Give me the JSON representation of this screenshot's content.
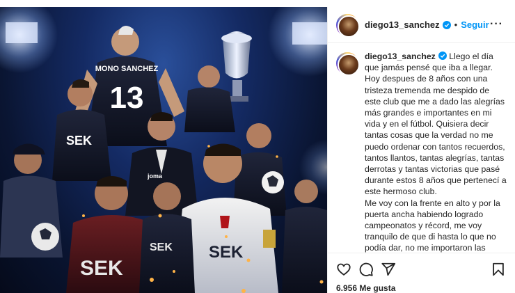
{
  "header": {
    "username": "diego13_sanchez",
    "separator": "•",
    "follow_label": "Seguir",
    "more_label": "···"
  },
  "caption": {
    "username": "diego13_sanchez",
    "paragraph1": "Llego el día que jamás pensé que iba a llegar. Hoy despues de 8 años con una tristeza tremenda me despido de este club que me a dado las alegrías más grandes e importantes en mi vida y en el fútbol. Quisiera decir tantas cosas que la verdad no me puedo ordenar con tantos recuerdos, tantos llantos, tantas alegrías, tantas derrotas y tantas victorias que pasé durante estos 8 años que pertenecí a este hermoso club.",
    "paragraph2": "Me voy con la frente en alto y por la puerta ancha habiendo logrado campeonatos y récord, me voy tranquilo de que di hasta lo que no podía dar, no me importaron las recomendaciones médicas siempre tuve en mente jugar todos los partidos sea como sea, talvez"
  },
  "image": {
    "jersey_name": "MONO SANCHEZ",
    "jersey_number": "13",
    "sponsor": "SEK",
    "brand": "joma"
  },
  "actions": {
    "likes_count": "6.956",
    "likes_label": "Me gusta"
  },
  "icons": [
    "verified-icon",
    "more-options-icon",
    "heart-icon",
    "comment-icon",
    "share-icon",
    "bookmark-icon"
  ],
  "colors": {
    "link_blue": "#0095f6",
    "verified_blue": "#0095f6",
    "text": "#262626",
    "border": "#efefef"
  }
}
